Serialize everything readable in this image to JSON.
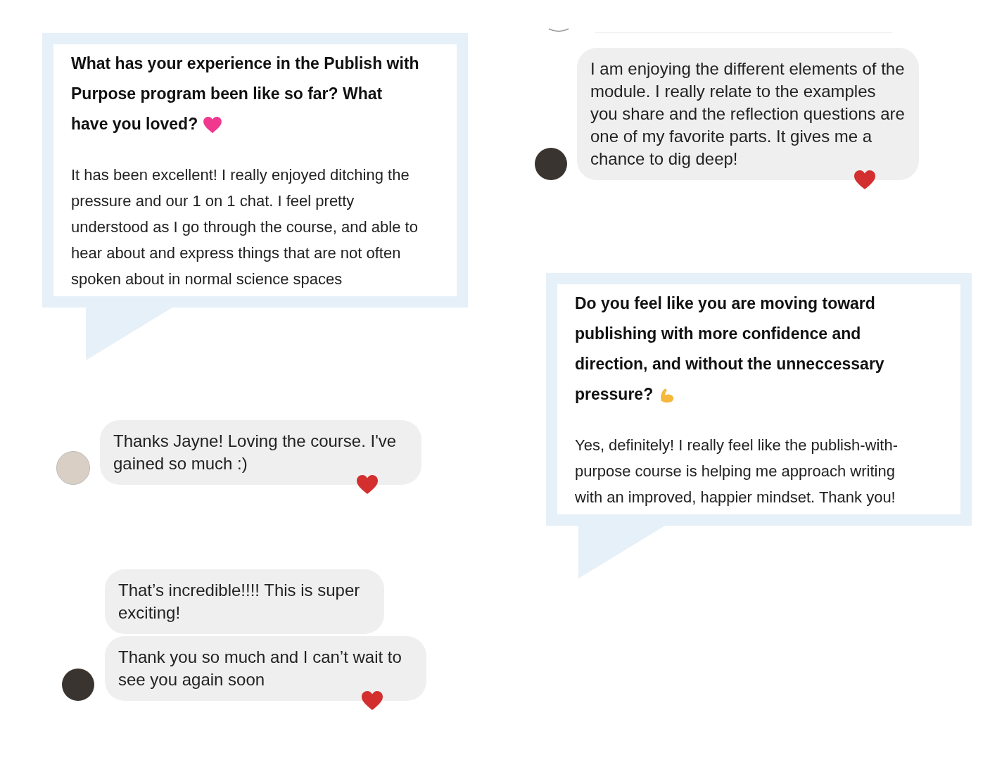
{
  "columns": [
    {
      "items": [
        {
          "kind": "card",
          "question": "What has your experience in the Publish with Purpose program been like so far? What have you loved?",
          "answer": "It has been excellent! I really enjoyed ditching the pressure and our 1 on 1 chat. I feel pretty understood as I go through the course, and able to hear about and express things that are not often spoken about in normal science spaces"
        },
        {
          "kind": "chat",
          "bubbles": [
            {
              "text": "Thanks Jayne! Loving the course. I've gained so much :)",
              "liked": true
            }
          ]
        },
        {
          "kind": "chat",
          "bubbles": [
            {
              "text": "That’s incredible!!!! This is super exciting!",
              "liked": false
            },
            {
              "text": "Thank you so much and I can’t wait to see you again soon",
              "liked": true
            }
          ]
        }
      ]
    },
    {
      "items": [
        {
          "kind": "divider"
        },
        {
          "kind": "chat",
          "bubbles": [
            {
              "text": "I am enjoying the different elements of the module. I really relate to the examples you share and the reflection questions are one of my favorite parts. It gives me a chance to dig deep!",
              "liked": true
            }
          ]
        },
        {
          "kind": "card",
          "question": "Do you feel like you are moving toward publishing with more confidence and direction, and without the unneccessary pressure?",
          "answer": "Yes, definitely! I really feel like the publish-with-purpose course is helping me approach writing with an improved, happier mindset. Thank you!"
        }
      ]
    }
  ]
}
